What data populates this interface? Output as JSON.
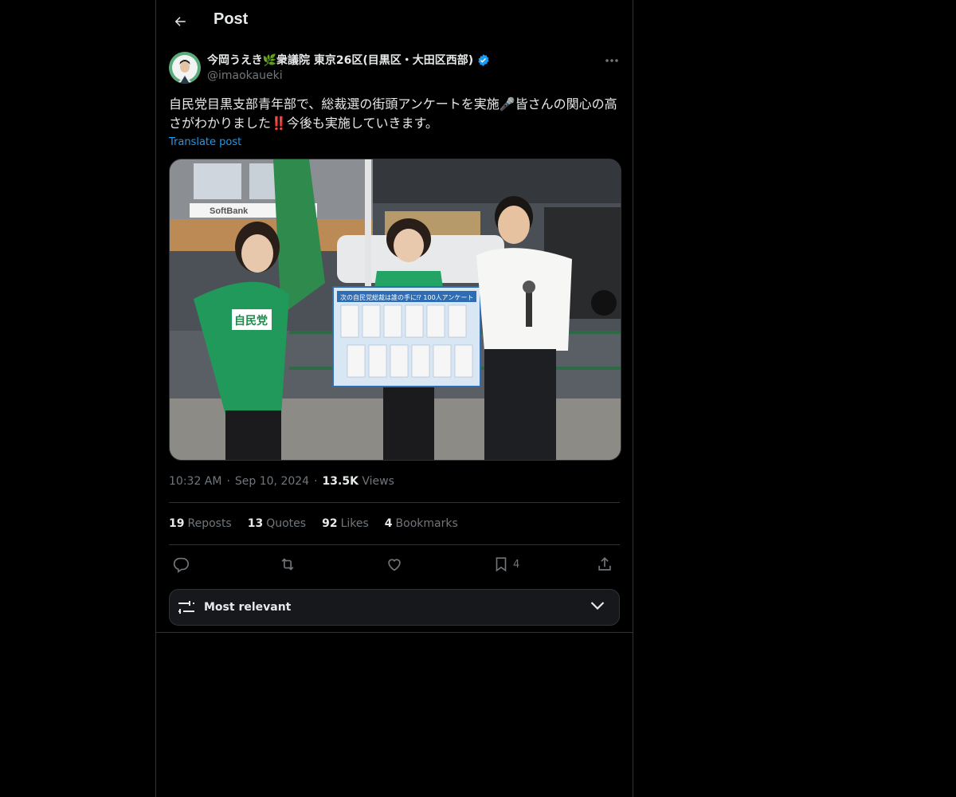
{
  "header": {
    "title": "Post"
  },
  "author": {
    "display_name": "今岡うえき🌿衆議院 東京26区(目黒区・大田区西部)",
    "handle": "@imaokaueki",
    "verified": true
  },
  "post": {
    "text": "自民党目黒支部青年部で、総裁選の街頭アンケートを実施🎤皆さんの関心の高さがわかりました‼️今後も実施していきます。",
    "translate_label": "Translate post",
    "media_alt": "Three people at a street survey board under a station overpass; woman in green 自民党 shirt, woman holding board, man with microphone",
    "media_shirt_text": "自民党",
    "media_board_title": "次の自民党総裁は誰の手に⁉ 100人アンケート",
    "media_shop_sign": "SoftBank",
    "time": "10:32 AM",
    "date": "Sep 10, 2024",
    "views_count": "13.5K",
    "views_label": "Views"
  },
  "stats": {
    "reposts_count": "19",
    "reposts_label": "Reposts",
    "quotes_count": "13",
    "quotes_label": "Quotes",
    "likes_count": "92",
    "likes_label": "Likes",
    "bookmarks_count": "4",
    "bookmarks_label": "Bookmarks"
  },
  "actions": {
    "bookmark_count": "4"
  },
  "sort": {
    "label": "Most relevant"
  },
  "colors": {
    "background": "#000000",
    "text": "#e7e9ea",
    "muted": "#71767b",
    "accent": "#1d9bf0",
    "border": "#2f3336",
    "verified": "#1d9bf0"
  },
  "icons": [
    "back-arrow-icon",
    "verified-badge-icon",
    "more-icon",
    "reply-icon",
    "repost-icon",
    "like-icon",
    "bookmark-icon",
    "share-icon",
    "sort-sliders-icon",
    "chevron-down-icon"
  ]
}
